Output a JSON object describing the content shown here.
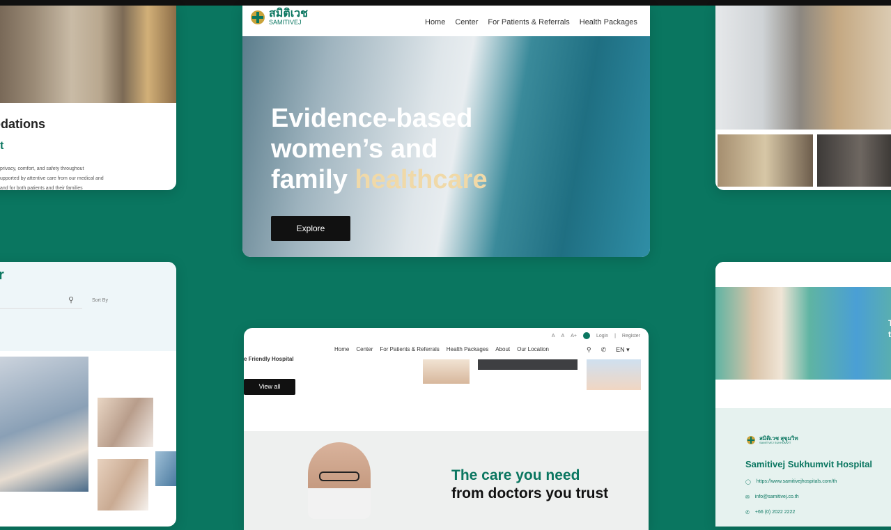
{
  "colors": {
    "background": "#0a7660",
    "accent": "#0a7660",
    "highlight": "#f0d9a8",
    "button": "#111111"
  },
  "accommodations": {
    "title": "odations",
    "subtitle": "t",
    "body": [
      "privacy, comfort, and safety throughout",
      "upported by attentive care from our medical and",
      "and for both patients and their families"
    ]
  },
  "hero_site": {
    "logo_thai": "สมิติเวช",
    "logo_en": "SAMITIVEJ",
    "nav": [
      "Home",
      "Center",
      "For Patients & Referrals",
      "Health Packages"
    ],
    "headline_line1": "Evidence-based",
    "headline_line2": "women’s and",
    "headline_line3_plain": "family ",
    "headline_line3_highlight": "healthcare",
    "explore_label": "Explore"
  },
  "search_card": {
    "heading_mark": "r",
    "search_icon": "search-icon",
    "sort_label": "Sort By"
  },
  "doctor_site": {
    "utility": {
      "font_small": "A",
      "font_medium": "A",
      "font_large": "A+",
      "login": "Login",
      "separator": "|",
      "register": "Register"
    },
    "nav": [
      "Home",
      "Center",
      "For Patients & Referrals",
      "Health Packages",
      "About",
      "Our Location"
    ],
    "lang": "EN ▾",
    "search_icon": "search-icon",
    "phone_icon": "phone-icon",
    "tag_text": "e Friendly Hospital",
    "view_all_label": "View all",
    "headline_line1": "The care you need",
    "headline_line2": "from doctors you trust"
  },
  "contact_card": {
    "side_text": [
      "T",
      "t"
    ],
    "logo_thai": "สมิติเวช สุขุมวิท",
    "logo_en": "SAMITIVEJ SUKHUMVIT",
    "hospital_name": "Samitivej Sukhumvit Hospital",
    "website": "https://www.samitivejhospitals.com/th",
    "email": "info@samitivej.co.th",
    "phone": "+66 (0) 2022 2222",
    "icons": [
      "globe-icon",
      "mail-icon",
      "phone-icon"
    ]
  }
}
